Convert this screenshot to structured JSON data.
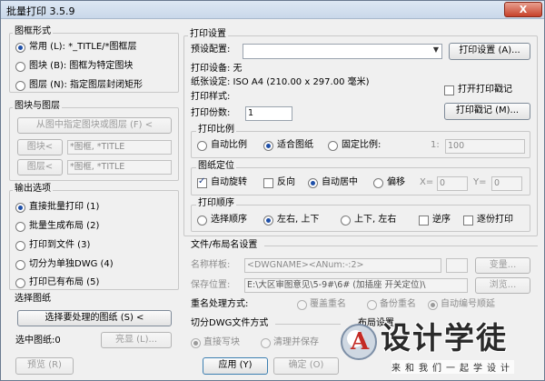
{
  "window": {
    "title": "批量打印 3.5.9",
    "close_label": "X"
  },
  "drawing_form": {
    "title": "图框形式",
    "options": [
      {
        "label": "常用 (L): *_TITLE/*图框层",
        "selected": true
      },
      {
        "label": "图块 (B): 图框为特定图块",
        "selected": false
      },
      {
        "label": "图层 (N): 指定图层封闭矩形",
        "selected": false
      }
    ]
  },
  "block_layer": {
    "title": "图块与图层",
    "pick_button": "从图中指定图块或图层 (F) <",
    "block_button": "图块<",
    "block_value": "*图框, *TITLE",
    "layer_button": "图层<",
    "layer_value": "*图框, *TITLE"
  },
  "output": {
    "title": "输出选项",
    "options": [
      {
        "label": "直接批量打印 (1)",
        "selected": true
      },
      {
        "label": "批量生成布局 (2)",
        "selected": false
      },
      {
        "label": "打印到文件 (3)",
        "selected": false
      },
      {
        "label": "切分为单独DWG (4)",
        "selected": false
      },
      {
        "label": "打印已有布局 (5)",
        "selected": false
      }
    ]
  },
  "select_drawings": {
    "title": "选择图纸",
    "select_button": "选择要处理的图纸 (S) <",
    "selected_label": "选中图纸:0",
    "highlight_button": "亮显 (L)..."
  },
  "print_settings": {
    "title": "打印设置",
    "preset_label": "预设配置:",
    "preset_value": "",
    "settings_button": "打印设置 (A)...",
    "device_label": "打印设备: 无",
    "paper_label": "纸张设定: ISO A4 (210.00 x 297.00 毫米)",
    "style_label": "打印样式:",
    "stamp_checkbox": "打开打印戳记",
    "stamp_checked": false,
    "copies_label": "打印份数:",
    "copies_value": "1",
    "stamp_button": "打印戳记 (M)..."
  },
  "scale": {
    "title": "打印比例",
    "options": [
      {
        "label": "自动比例",
        "selected": false
      },
      {
        "label": "适合图纸",
        "selected": true
      },
      {
        "label": "固定比例:",
        "selected": false
      }
    ],
    "ratio_prefix": "1:",
    "ratio_value": "100"
  },
  "position": {
    "title": "图纸定位",
    "auto_rotate": "自动旋转",
    "auto_rotate_checked": true,
    "reverse": "反向",
    "reverse_checked": false,
    "center": "自动居中",
    "center_selected": true,
    "offset": "偏移",
    "offset_selected": false,
    "x_label": "X=",
    "x_value": "0",
    "y_label": "Y=",
    "y_value": "0"
  },
  "order": {
    "title": "打印顺序",
    "options": [
      {
        "label": "选择顺序",
        "selected": false
      },
      {
        "label": "左右, 上下",
        "selected": true
      },
      {
        "label": "上下, 左右",
        "selected": false
      }
    ],
    "reverse": "逆序",
    "reverse_checked": false,
    "by_copy": "逐份打印",
    "by_copy_checked": false
  },
  "file_naming": {
    "title": "文件/布局名设置",
    "name_label": "名称样板:",
    "name_value": "<DWGNAME><ANum:-:2>",
    "vars_button": "变量...",
    "path_label": "保存位置:",
    "path_value": "E:\\大区审图意见\\5-9#\\6# (加插座 开关定位)\\",
    "browse_button": "浏览...",
    "dup_label": "重名处理方式:",
    "dup_options": [
      {
        "label": "覆盖重名",
        "selected": false
      },
      {
        "label": "备份重名",
        "selected": false
      },
      {
        "label": "自动编号顺延",
        "selected": true
      }
    ]
  },
  "split_dwg": {
    "title": "切分DWG文件方式",
    "options": [
      {
        "label": "直接写块",
        "selected": true
      },
      {
        "label": "清理并保存",
        "selected": false
      }
    ]
  },
  "layout": {
    "title": "布局设置"
  },
  "footer": {
    "preview_button": "预览 (R)",
    "apply_button": "应用 (Y)",
    "ok_button": "确定 (O)"
  },
  "watermark": {
    "logo_letter": "A",
    "title": "设计学徒",
    "subtitle": "来和我们一起学设计"
  }
}
